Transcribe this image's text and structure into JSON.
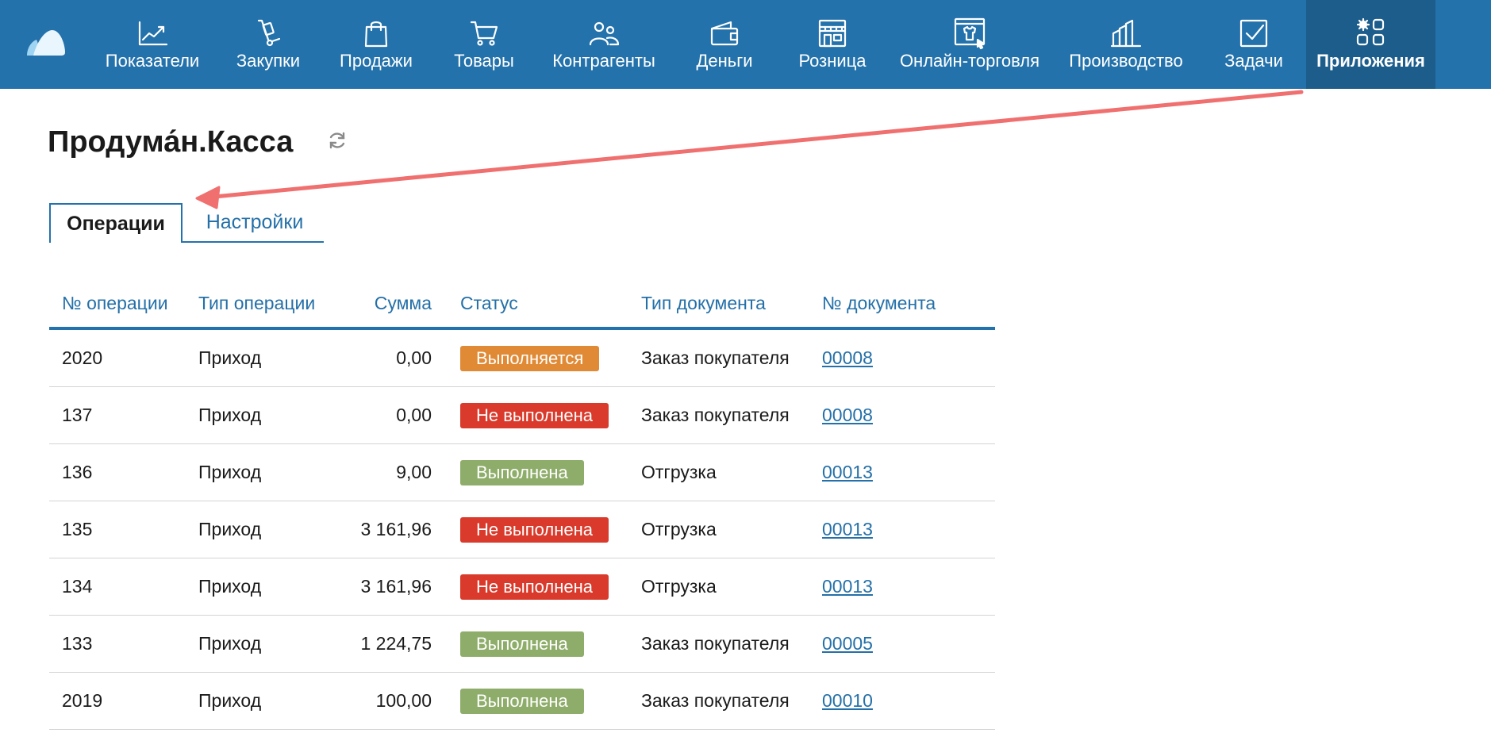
{
  "colors": {
    "nav_bg": "#2472ab",
    "nav_active_bg": "#1c5d8c",
    "link": "#2470a8",
    "status_in_progress": "#e08a36",
    "status_failed": "#d93a2b",
    "status_done": "#8fad6a",
    "annotation_arrow": "#f07070"
  },
  "nav": {
    "items": [
      {
        "label": "Показатели",
        "icon": "chart-line-icon"
      },
      {
        "label": "Закупки",
        "icon": "hand-truck-icon"
      },
      {
        "label": "Продажи",
        "icon": "shopping-bag-icon"
      },
      {
        "label": "Товары",
        "icon": "shopping-cart-icon"
      },
      {
        "label": "Контрагенты",
        "icon": "people-icon"
      },
      {
        "label": "Деньги",
        "icon": "wallet-icon"
      },
      {
        "label": "Розница",
        "icon": "storefront-icon"
      },
      {
        "label": "Онлайн-торговля",
        "icon": "online-store-icon"
      },
      {
        "label": "Производство",
        "icon": "factory-icon"
      },
      {
        "label": "Задачи",
        "icon": "checkbox-icon"
      },
      {
        "label": "Приложения",
        "icon": "apps-icon"
      }
    ],
    "active_index": 10
  },
  "page": {
    "title": "Продума́н.Касса"
  },
  "tabs": [
    {
      "label": "Операции",
      "active": true
    },
    {
      "label": "Настройки",
      "active": false
    }
  ],
  "table": {
    "columns": [
      "№ операции",
      "Тип операции",
      "Сумма",
      "Статус",
      "Тип документа",
      "№ документа"
    ],
    "rows": [
      {
        "op_number": "2020",
        "op_type": "Приход",
        "amount": "0,00",
        "status": "Выполняется",
        "status_kind": "progress",
        "doc_type": "Заказ покупателя",
        "doc_number": "00008"
      },
      {
        "op_number": "137",
        "op_type": "Приход",
        "amount": "0,00",
        "status": "Не выполнена",
        "status_kind": "failed",
        "doc_type": "Заказ покупателя",
        "doc_number": "00008"
      },
      {
        "op_number": "136",
        "op_type": "Приход",
        "amount": "9,00",
        "status": "Выполнена",
        "status_kind": "done",
        "doc_type": "Отгрузка",
        "doc_number": "00013"
      },
      {
        "op_number": "135",
        "op_type": "Приход",
        "amount": "3 161,96",
        "status": "Не выполнена",
        "status_kind": "failed",
        "doc_type": "Отгрузка",
        "doc_number": "00013"
      },
      {
        "op_number": "134",
        "op_type": "Приход",
        "amount": "3 161,96",
        "status": "Не выполнена",
        "status_kind": "failed",
        "doc_type": "Отгрузка",
        "doc_number": "00013"
      },
      {
        "op_number": "133",
        "op_type": "Приход",
        "amount": "1 224,75",
        "status": "Выполнена",
        "status_kind": "done",
        "doc_type": "Заказ покупателя",
        "doc_number": "00005"
      },
      {
        "op_number": "2019",
        "op_type": "Приход",
        "amount": "100,00",
        "status": "Выполнена",
        "status_kind": "done",
        "doc_type": "Заказ покупателя",
        "doc_number": "00010"
      }
    ]
  }
}
